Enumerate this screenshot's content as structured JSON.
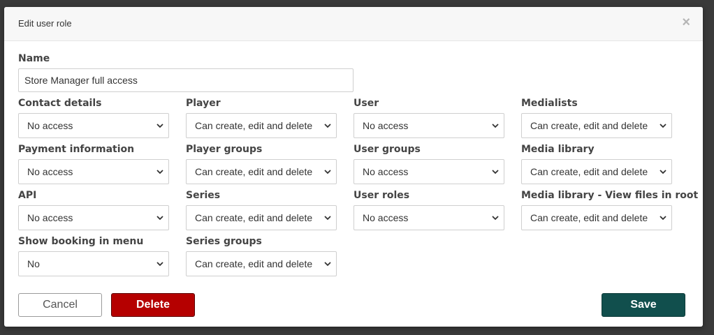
{
  "dialog": {
    "title": "Edit user role",
    "close_label": "×"
  },
  "name": {
    "label": "Name",
    "value": "Store Manager full access"
  },
  "columns": [
    {
      "fields": [
        {
          "label": "Contact details",
          "value": "No access"
        },
        {
          "label": "Payment information",
          "value": "No access"
        },
        {
          "label": "API",
          "value": "No access"
        },
        {
          "label": "Show booking in menu",
          "value": "No"
        }
      ]
    },
    {
      "fields": [
        {
          "label": "Player",
          "value": "Can create, edit and delete"
        },
        {
          "label": "Player groups",
          "value": "Can create, edit and delete"
        },
        {
          "label": "Series",
          "value": "Can create, edit and delete"
        },
        {
          "label": "Series groups",
          "value": "Can create, edit and delete"
        }
      ]
    },
    {
      "fields": [
        {
          "label": "User",
          "value": "No access"
        },
        {
          "label": "User groups",
          "value": "No access"
        },
        {
          "label": "User roles",
          "value": "No access"
        }
      ]
    },
    {
      "fields": [
        {
          "label": "Medialists",
          "value": "Can create, edit and delete"
        },
        {
          "label": "Media library",
          "value": "Can create, edit and delete"
        },
        {
          "label": "Media library - View files in root",
          "value": "Can create, edit and delete"
        }
      ]
    }
  ],
  "buttons": {
    "cancel": "Cancel",
    "delete": "Delete",
    "save": "Save"
  },
  "colors": {
    "delete": "#b50000",
    "save": "#114f4d"
  }
}
